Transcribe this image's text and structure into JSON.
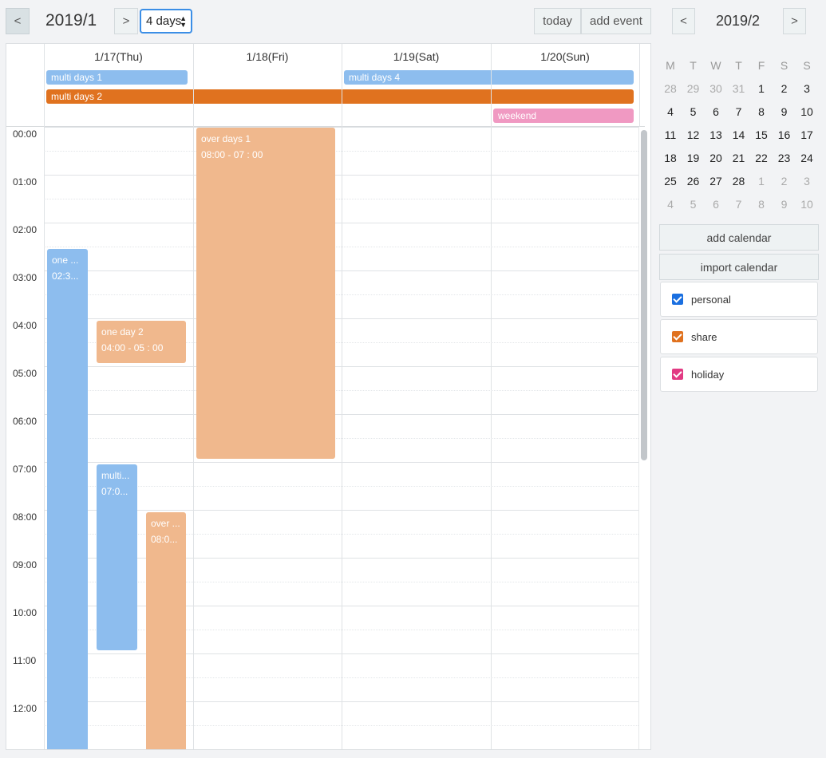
{
  "header": {
    "prev_label": "<",
    "next_label": ">",
    "month_title": "2019/1",
    "view_select_value": "4 days",
    "today_label": "today",
    "add_event_label": "add event"
  },
  "calendar": {
    "days": [
      "1/17(Thu)",
      "1/18(Fri)",
      "1/19(Sat)",
      "1/20(Sun)"
    ],
    "time_labels": [
      "00:00",
      "01:00",
      "02:00",
      "03:00",
      "04:00",
      "05:00",
      "06:00",
      "07:00",
      "08:00",
      "09:00",
      "10:00",
      "11:00",
      "12:00"
    ],
    "allday_events": [
      {
        "title": "multi days 1",
        "color": "#8dbdee"
      },
      {
        "title": "multi days 4",
        "color": "#8dbdee"
      },
      {
        "title": "multi days 2",
        "color": "#e0721f"
      },
      {
        "title": "weekend",
        "color": "#f099c2"
      }
    ],
    "events": [
      {
        "title": "one ...",
        "time": "02:3...",
        "color": "#8dbdee"
      },
      {
        "title": "one day 2",
        "time": "04:00 - 05 : 00",
        "color": "#f0b88d"
      },
      {
        "title": "multi...",
        "time": "07:0...",
        "color": "#8dbdee"
      },
      {
        "title": "over ...",
        "time": "08:0...",
        "color": "#f0b88d"
      },
      {
        "title": "over days 1",
        "time": "08:00 - 07 : 00",
        "color": "#f0b88d"
      }
    ]
  },
  "sidebar": {
    "prev_label": "<",
    "next_label": ">",
    "month_title": "2019/2",
    "weekdays": [
      "M",
      "T",
      "W",
      "T",
      "F",
      "S",
      "S"
    ],
    "weeks": [
      [
        {
          "d": "28",
          "o": true
        },
        {
          "d": "29",
          "o": true
        },
        {
          "d": "30",
          "o": true
        },
        {
          "d": "31",
          "o": true
        },
        {
          "d": "1"
        },
        {
          "d": "2"
        },
        {
          "d": "3"
        }
      ],
      [
        {
          "d": "4"
        },
        {
          "d": "5"
        },
        {
          "d": "6"
        },
        {
          "d": "7"
        },
        {
          "d": "8"
        },
        {
          "d": "9"
        },
        {
          "d": "10"
        }
      ],
      [
        {
          "d": "11"
        },
        {
          "d": "12"
        },
        {
          "d": "13"
        },
        {
          "d": "14"
        },
        {
          "d": "15"
        },
        {
          "d": "16"
        },
        {
          "d": "17"
        }
      ],
      [
        {
          "d": "18"
        },
        {
          "d": "19"
        },
        {
          "d": "20"
        },
        {
          "d": "21"
        },
        {
          "d": "22"
        },
        {
          "d": "23"
        },
        {
          "d": "24"
        }
      ],
      [
        {
          "d": "25"
        },
        {
          "d": "26"
        },
        {
          "d": "27"
        },
        {
          "d": "28"
        },
        {
          "d": "1",
          "o": true
        },
        {
          "d": "2",
          "o": true
        },
        {
          "d": "3",
          "o": true
        }
      ],
      [
        {
          "d": "4",
          "o": true
        },
        {
          "d": "5",
          "o": true
        },
        {
          "d": "6",
          "o": true
        },
        {
          "d": "7",
          "o": true
        },
        {
          "d": "8",
          "o": true
        },
        {
          "d": "9",
          "o": true
        },
        {
          "d": "10",
          "o": true
        }
      ]
    ],
    "add_calendar_label": "add calendar",
    "import_calendar_label": "import calendar",
    "calendars": [
      {
        "name": "personal",
        "color": "#1a6fe0",
        "checked": true
      },
      {
        "name": "share",
        "color": "#e0721f",
        "checked": true
      },
      {
        "name": "holiday",
        "color": "#e23a83",
        "checked": true
      }
    ]
  }
}
